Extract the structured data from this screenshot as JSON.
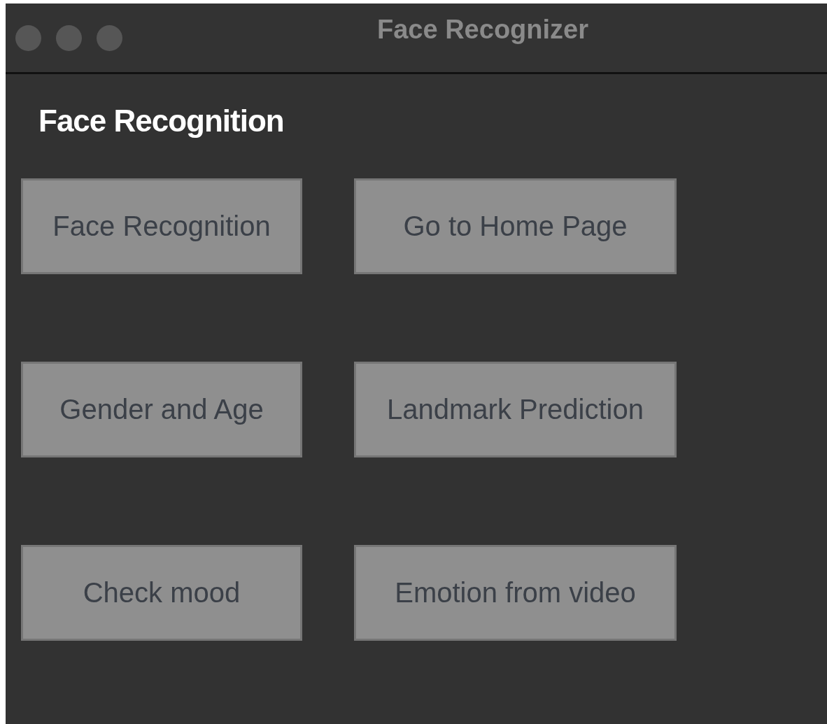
{
  "window": {
    "title": "Face Recognizer"
  },
  "heading": "Face Recognition",
  "buttons": [
    "Face Recognition",
    "Go to Home Page",
    "Gender and Age",
    "Landmark Prediction",
    "Check mood",
    "Emotion from video"
  ]
}
